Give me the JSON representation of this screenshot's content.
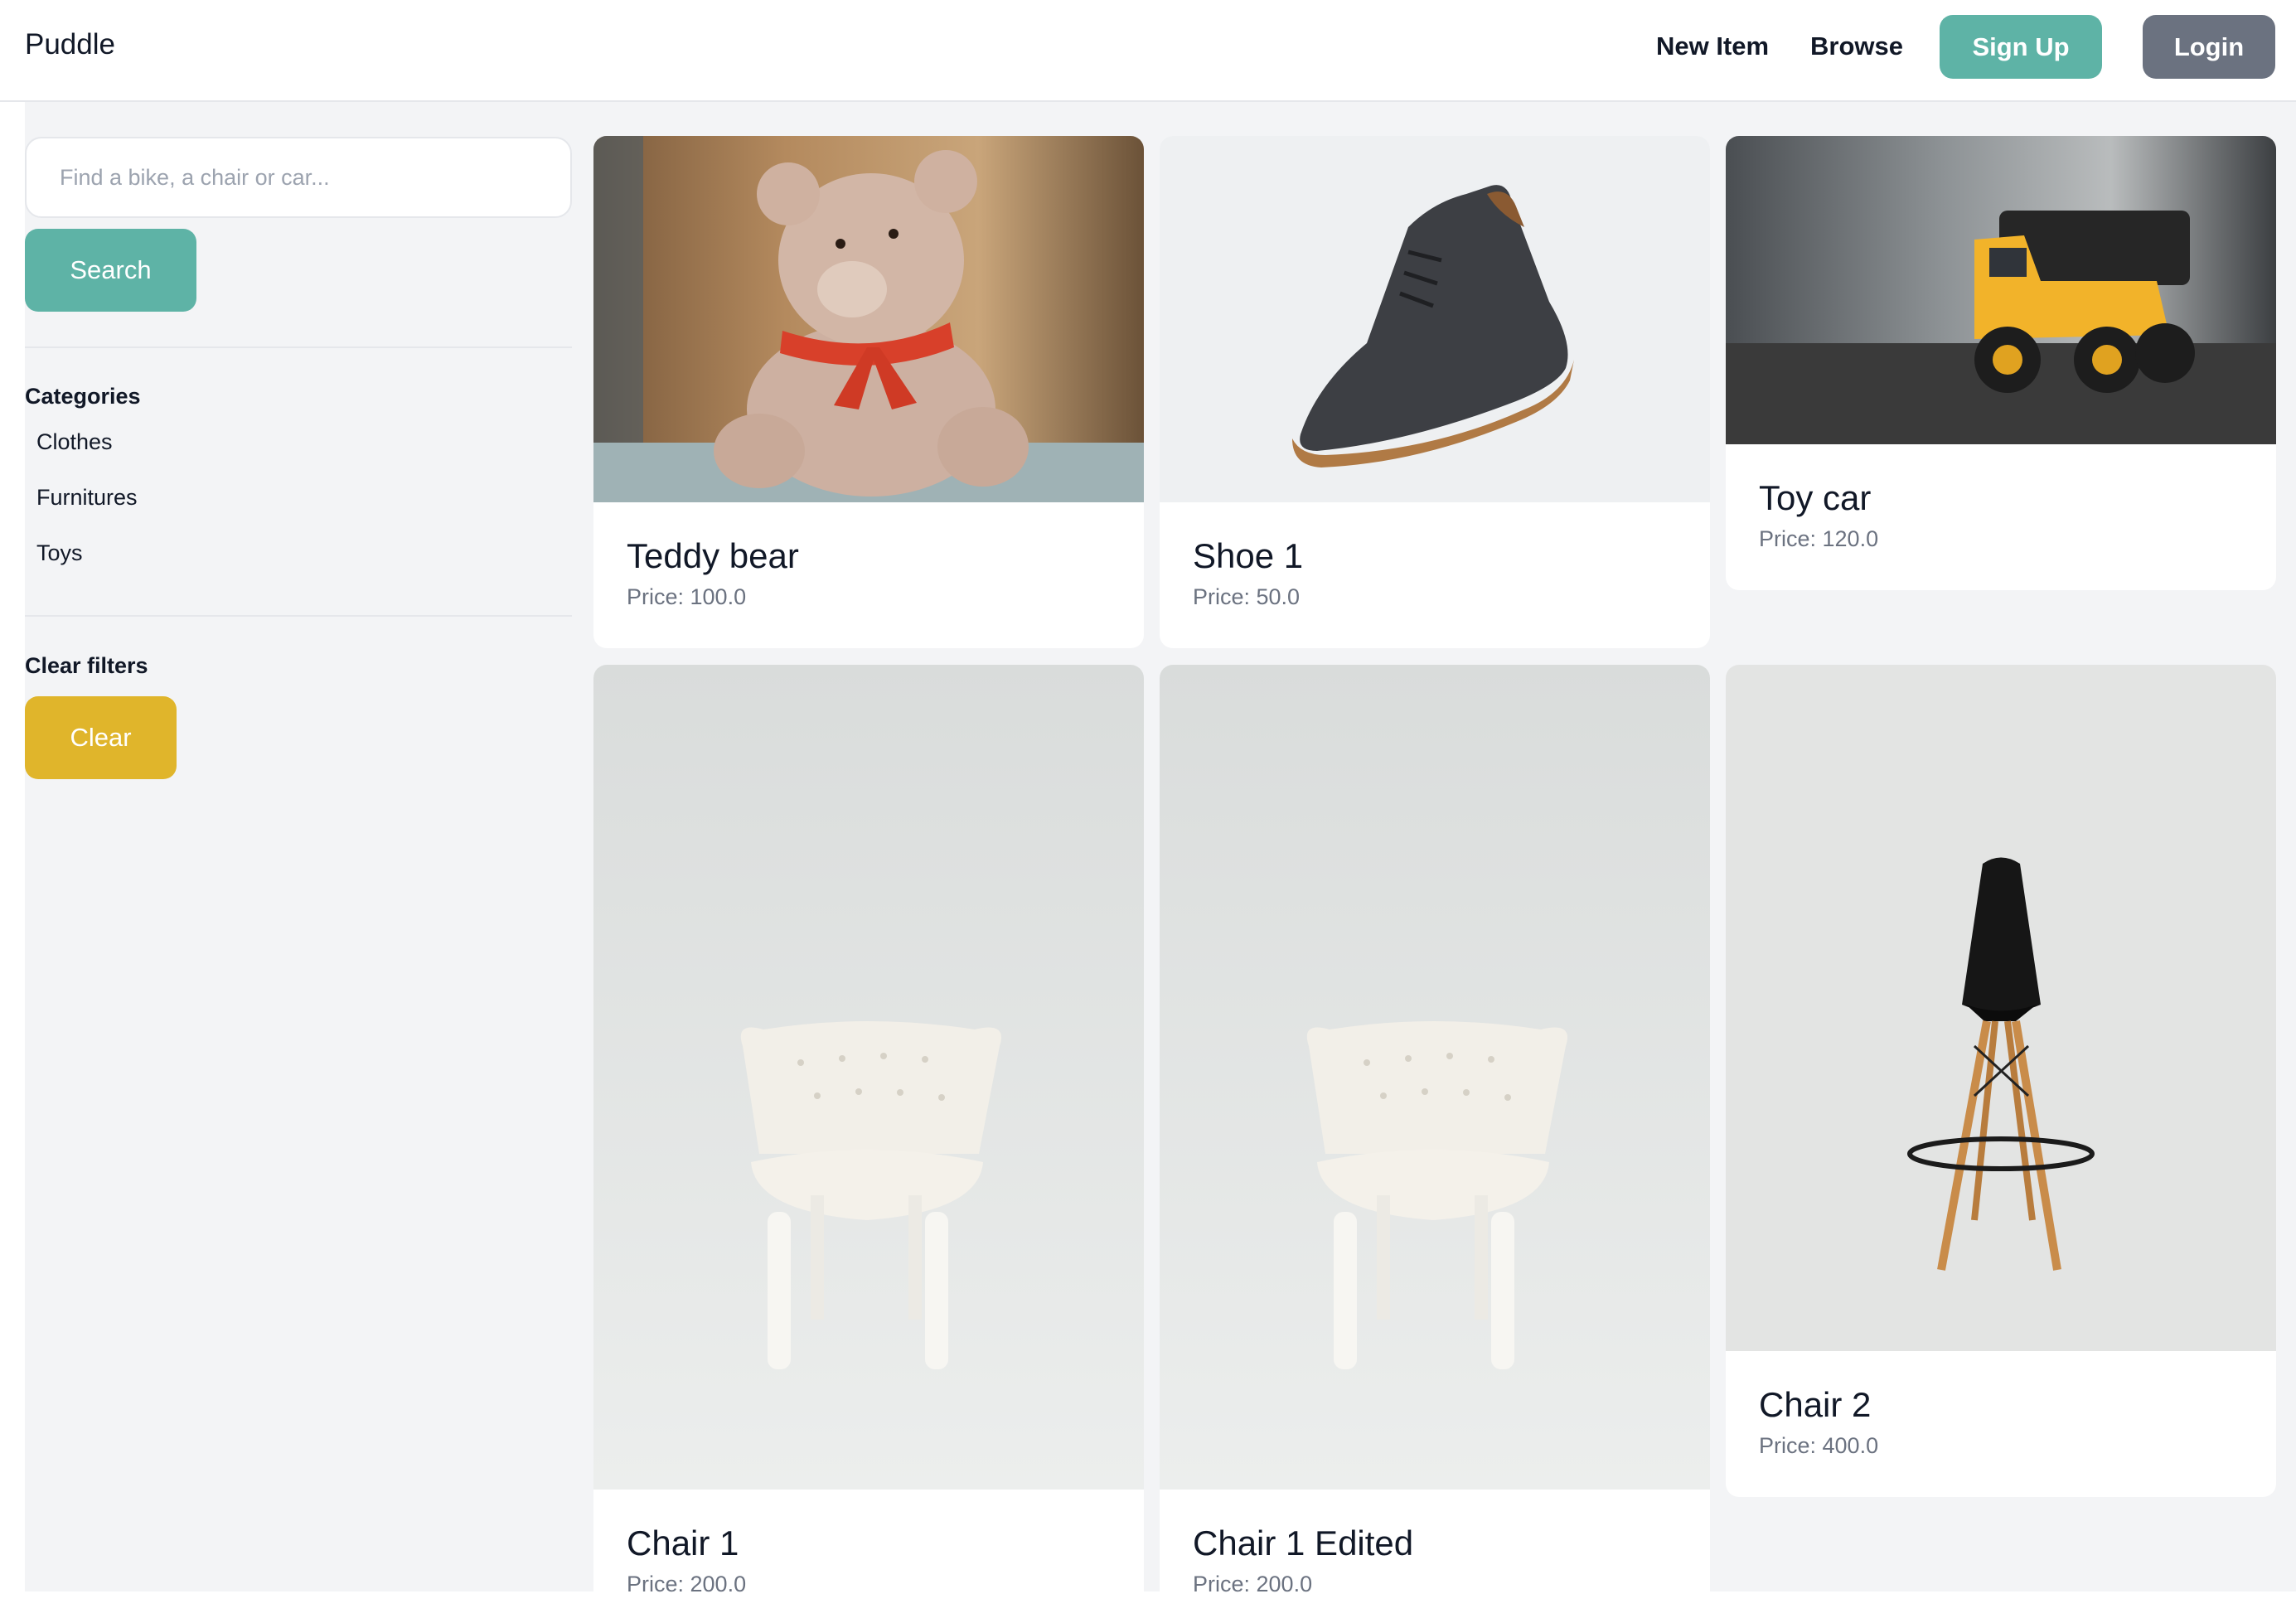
{
  "header": {
    "brand": "Puddle",
    "nav": {
      "new_item": "New Item",
      "browse": "Browse"
    },
    "sign_up": "Sign Up",
    "login": "Login"
  },
  "sidebar": {
    "search": {
      "placeholder": "Find a bike, a chair or car...",
      "button": "Search"
    },
    "categories_title": "Categories",
    "categories": [
      "Clothes",
      "Furnitures",
      "Toys"
    ],
    "clear_title": "Clear filters",
    "clear_button": "Clear"
  },
  "items": [
    {
      "name": "Teddy bear",
      "price": "Price: 100.0",
      "image": "teddy-bear-photo"
    },
    {
      "name": "Shoe 1",
      "price": "Price: 50.0",
      "image": "shoe-photo"
    },
    {
      "name": "Toy car",
      "price": "Price: 120.0",
      "image": "toy-truck-photo"
    },
    {
      "name": "Chair 1",
      "price": "Price: 200.0",
      "image": "white-armchair-photo"
    },
    {
      "name": "Chair 1 Edited",
      "price": "Price: 200.0",
      "image": "white-armchair-photo"
    },
    {
      "name": "Chair 2",
      "price": "Price: 400.0",
      "image": "black-bar-stool-photo"
    }
  ],
  "colors": {
    "accent": "#5eb3a6",
    "login": "#6b7280",
    "clear": "#e0b52b",
    "panel": "#f3f4f6"
  }
}
